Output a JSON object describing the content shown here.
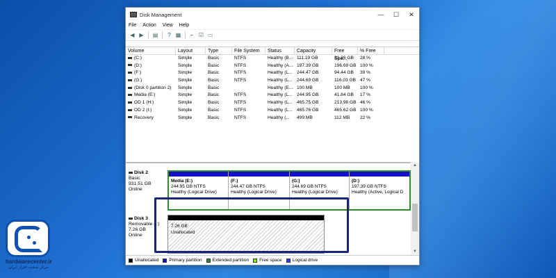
{
  "window": {
    "title": "Disk Management",
    "controls": {
      "minimize": "—",
      "maximize": "☐",
      "close": "✕"
    }
  },
  "menu": [
    "File",
    "Action",
    "View",
    "Help"
  ],
  "table": {
    "headers": [
      "Volume",
      "Layout",
      "Type",
      "File System",
      "Status",
      "Capacity",
      "Free Spa...",
      "% Free"
    ],
    "rows": [
      [
        "(C:)",
        "Simple",
        "Basic",
        "NTFS",
        "Healthy (B...",
        "111.19 GB",
        "31.26 GB",
        "28 %"
      ],
      [
        "(D:)",
        "Simple",
        "Basic",
        "NTFS",
        "Healthy (A...",
        "197.39 GB",
        "196.69 GB",
        "100 %"
      ],
      [
        "(F:)",
        "Simple",
        "Basic",
        "NTFS",
        "Healthy (L...",
        "244.47 GB",
        "94.44 GB",
        "39 %"
      ],
      [
        "(G:)",
        "Simple",
        "Basic",
        "NTFS",
        "Healthy (L...",
        "244.69 GB",
        "116.03 GB",
        "47 %"
      ],
      [
        "(Disk 0 partition 2)",
        "Simple",
        "Basic",
        "",
        "Healthy (E...",
        "100 MB",
        "100 MB",
        "100 %"
      ],
      [
        "Media (E:)",
        "Simple",
        "Basic",
        "NTFS",
        "Healthy (L...",
        "244.95 GB",
        "41.84 GB",
        "17 %"
      ],
      [
        "OD 1 (H:)",
        "Simple",
        "Basic",
        "NTFS",
        "Healthy (L...",
        "465.75 GB",
        "213.98 GB",
        "46 %"
      ],
      [
        "OD 2 (I:)",
        "Simple",
        "Basic",
        "NTFS",
        "Healthy (L...",
        "465.76 GB",
        "465.62 GB",
        "100 %"
      ],
      [
        "Recovery",
        "Simple",
        "Basic",
        "NTFS",
        "Healthy (...",
        "499 MB",
        "112 MB",
        "22 %"
      ]
    ]
  },
  "disk2": {
    "name": "Disk 2",
    "type": "Basic",
    "size": "931.51 GB",
    "status": "Online",
    "partitions": [
      {
        "name": "Media  (E:)",
        "size": "244.95 GB NTFS",
        "status": "Healthy (Logical Drive)"
      },
      {
        "name": "(F:)",
        "size": "244.47 GB NTFS",
        "status": "Healthy (Logical Drive)"
      },
      {
        "name": "(G:)",
        "size": "244.69 GB NTFS",
        "status": "Healthy (Logical Drive)"
      },
      {
        "name": "(D:)",
        "size": "197.39 GB NTFS",
        "status": "Healthy (Active, Logical D"
      }
    ]
  },
  "disk3": {
    "name": "Disk 3",
    "type": "Removable (I:)",
    "size": "7.26 GB",
    "status": "Online",
    "unallocated_size": "7.26 GB",
    "unallocated_label": "Unallocated"
  },
  "legend": [
    {
      "label": "Unallocated",
      "color": "#000000"
    },
    {
      "label": "Primary partition",
      "color": "#1510c8"
    },
    {
      "label": "Extended partition",
      "color": "#2e8b2e"
    },
    {
      "label": "Free space",
      "color": "#7cfc00"
    },
    {
      "label": "Logical drive",
      "color": "#2a3cff"
    }
  ],
  "brand": {
    "site": "hardwarecenter.ir",
    "tagline": "مرکز سخت افزار ایران"
  }
}
